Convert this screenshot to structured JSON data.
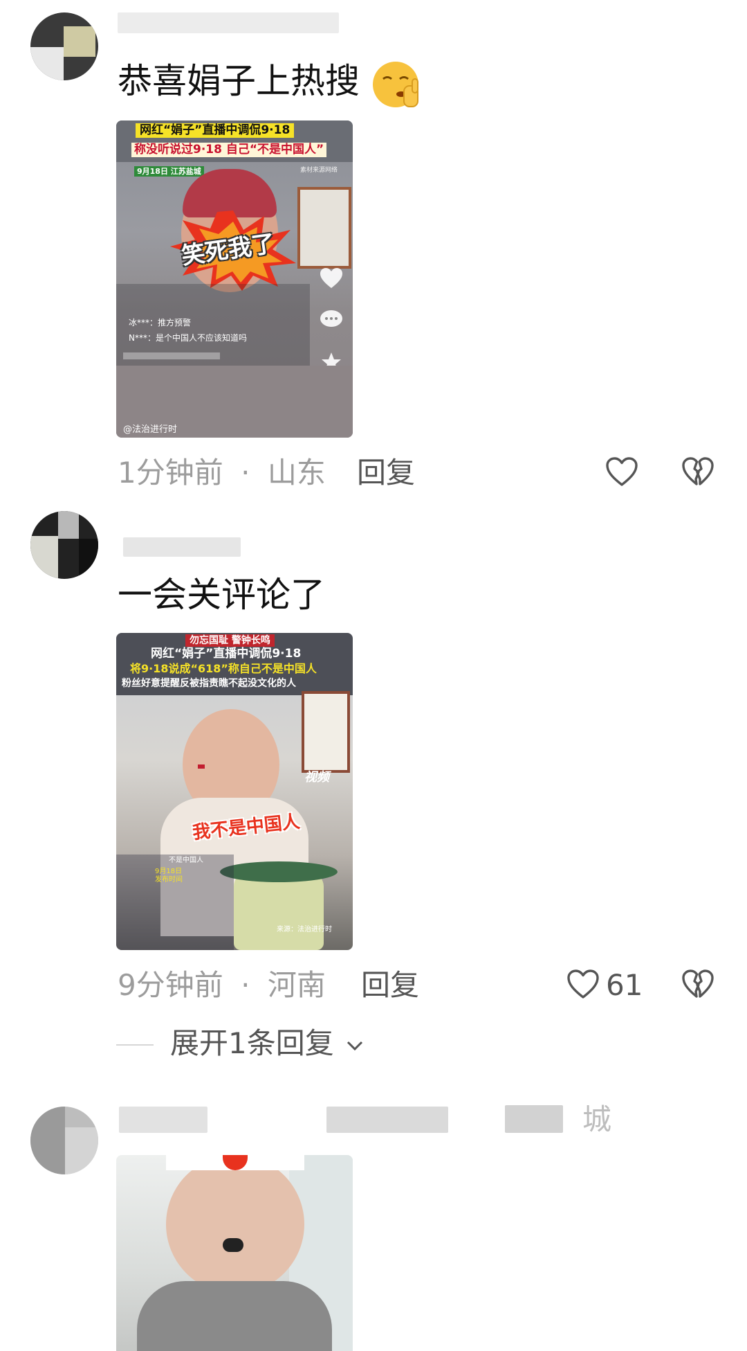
{
  "comments": [
    {
      "text": "恭喜娟子上热搜",
      "emoji_icon": "shushing-face-emoji",
      "image": {
        "line1": "网红“娟子”直播中调侃9·18",
        "line2": "称没听说过9·18 自己“不是中国人”",
        "badge": "9月18日 江苏盐城",
        "source": "素材来源网络",
        "sticker": "笑死我了",
        "chat": [
          "冰***：推方预警",
          "N***：是个中国人不应该知道吗"
        ],
        "watermark": "@法治进行时"
      },
      "time": "1分钟前",
      "location": "山东",
      "separator": "·",
      "reply_label": "回复",
      "likes": ""
    },
    {
      "text": "一会关评论了",
      "image": {
        "top_banner": "勿忘国耻 警钟长鸣",
        "line1": "网红“娟子”直播中调侃9·18",
        "line2": "将9·18说成“618”称自己不是中国人",
        "line3": "粉丝好意提醒反被指责瞧不起没文化的人",
        "logo": "视频",
        "sticker": "我不是中国人",
        "chat": [
          "不是中国人",
          "9月18日",
          "发布时间"
        ],
        "source": "来源：法治进行时"
      },
      "time": "9分钟前",
      "location": "河南",
      "separator": "·",
      "reply_label": "回复",
      "likes": "61",
      "expand_label": "展开1条回复"
    },
    {
      "username_tail": "城"
    }
  ],
  "colors": {
    "meta_gray": "#9c9c9c",
    "text_dark": "#111111",
    "banner_yellow": "#f6e227",
    "sticker_red": "#e8321e"
  }
}
